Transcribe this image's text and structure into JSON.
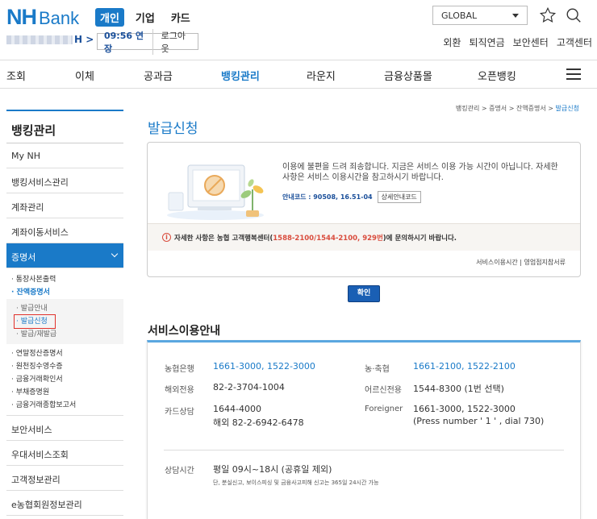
{
  "header": {
    "logo_nh": "NH",
    "logo_bank": "Bank",
    "tabs": [
      "개인",
      "기업",
      "카드"
    ],
    "global": "GLOBAL",
    "user_suffix": "H >",
    "session_timer": "09:56 연장",
    "logout": "로그아웃",
    "util_links": [
      "외환",
      "퇴직연금",
      "보안센터",
      "고객센터"
    ]
  },
  "gnb": [
    "조회",
    "이체",
    "공과금",
    "뱅킹관리",
    "라운지",
    "금융상품몰",
    "오픈뱅킹"
  ],
  "sidebar": {
    "title": "뱅킹관리",
    "items_top": [
      "My NH",
      "뱅킹서비스관리",
      "계좌관리",
      "계좌이동서비스"
    ],
    "active": "증명서",
    "sub_a": [
      "· 통장사본출력",
      "· 잔액증명서"
    ],
    "sub2": [
      "· 발급안내",
      "· 발급신청",
      "· 발급/재발급"
    ],
    "sub_b": [
      "· 연말정산증명서",
      "· 원천징수영수증",
      "· 금융거래확인서",
      "· 부채증명원",
      "· 금융거래종합보고서"
    ],
    "items_bottom": [
      "보안서비스",
      "우대서비스조회",
      "고객정보관리",
      "e농협회원정보관리"
    ]
  },
  "breadcrumb": {
    "path": "뱅킹관리 > 증명서 > 잔액증명서 > ",
    "current": "발급신청"
  },
  "page_title": "발급신청",
  "notice": {
    "message": "이용에 불편을 드려 죄송합니다. 지금은 서비스 이용 가능 시간이 아닙니다. 자세한 사항은 서비스 이용시간을 참고하시기 바랍니다.",
    "code": "안내코드 : 90508, 16.51-04",
    "detail_button": "상세안내코드",
    "warn_prefix": "자세한 사항은 농협 고객행복센터(",
    "warn_numbers": "1588-2100/1544-2100, 929번",
    "warn_suffix": ")에 문의하시기 바랍니다.",
    "footer": "서비스이용시간 | 영업점지참서류"
  },
  "confirm": "확인",
  "service": {
    "title": "서비스이용안내",
    "rows": {
      "nh_bank_label": "농협은행",
      "nh_bank_val": "1661-3000, 1522-3000",
      "nh_coop_label": "농·축협",
      "nh_coop_val": "1661-2100, 1522-2100",
      "overseas_label": "해외전용",
      "overseas_val": "82-2-3704-1004",
      "senior_label": "어르신전용",
      "senior_val": "1544-8300 (1번 선택)",
      "card_label": "카드상담",
      "card_val1": "1644-4000",
      "card_val2": "해외 82-2-6942-6478",
      "foreigner_label": "Foreigner",
      "foreigner_val1": "1661-3000, 1522-3000",
      "foreigner_val2": "(Press number ' 1 ' , dial 730)",
      "hours_label": "상담시간",
      "hours_val": "평일 09시~18시 (공휴일 제외)",
      "hours_note": "단, 분실신고, 보이스피싱 및 금융사고피해 신고는 365일 24시간 가능"
    }
  },
  "colors": {
    "brand": "#1a7ac8",
    "warn": "#d94c3d"
  }
}
